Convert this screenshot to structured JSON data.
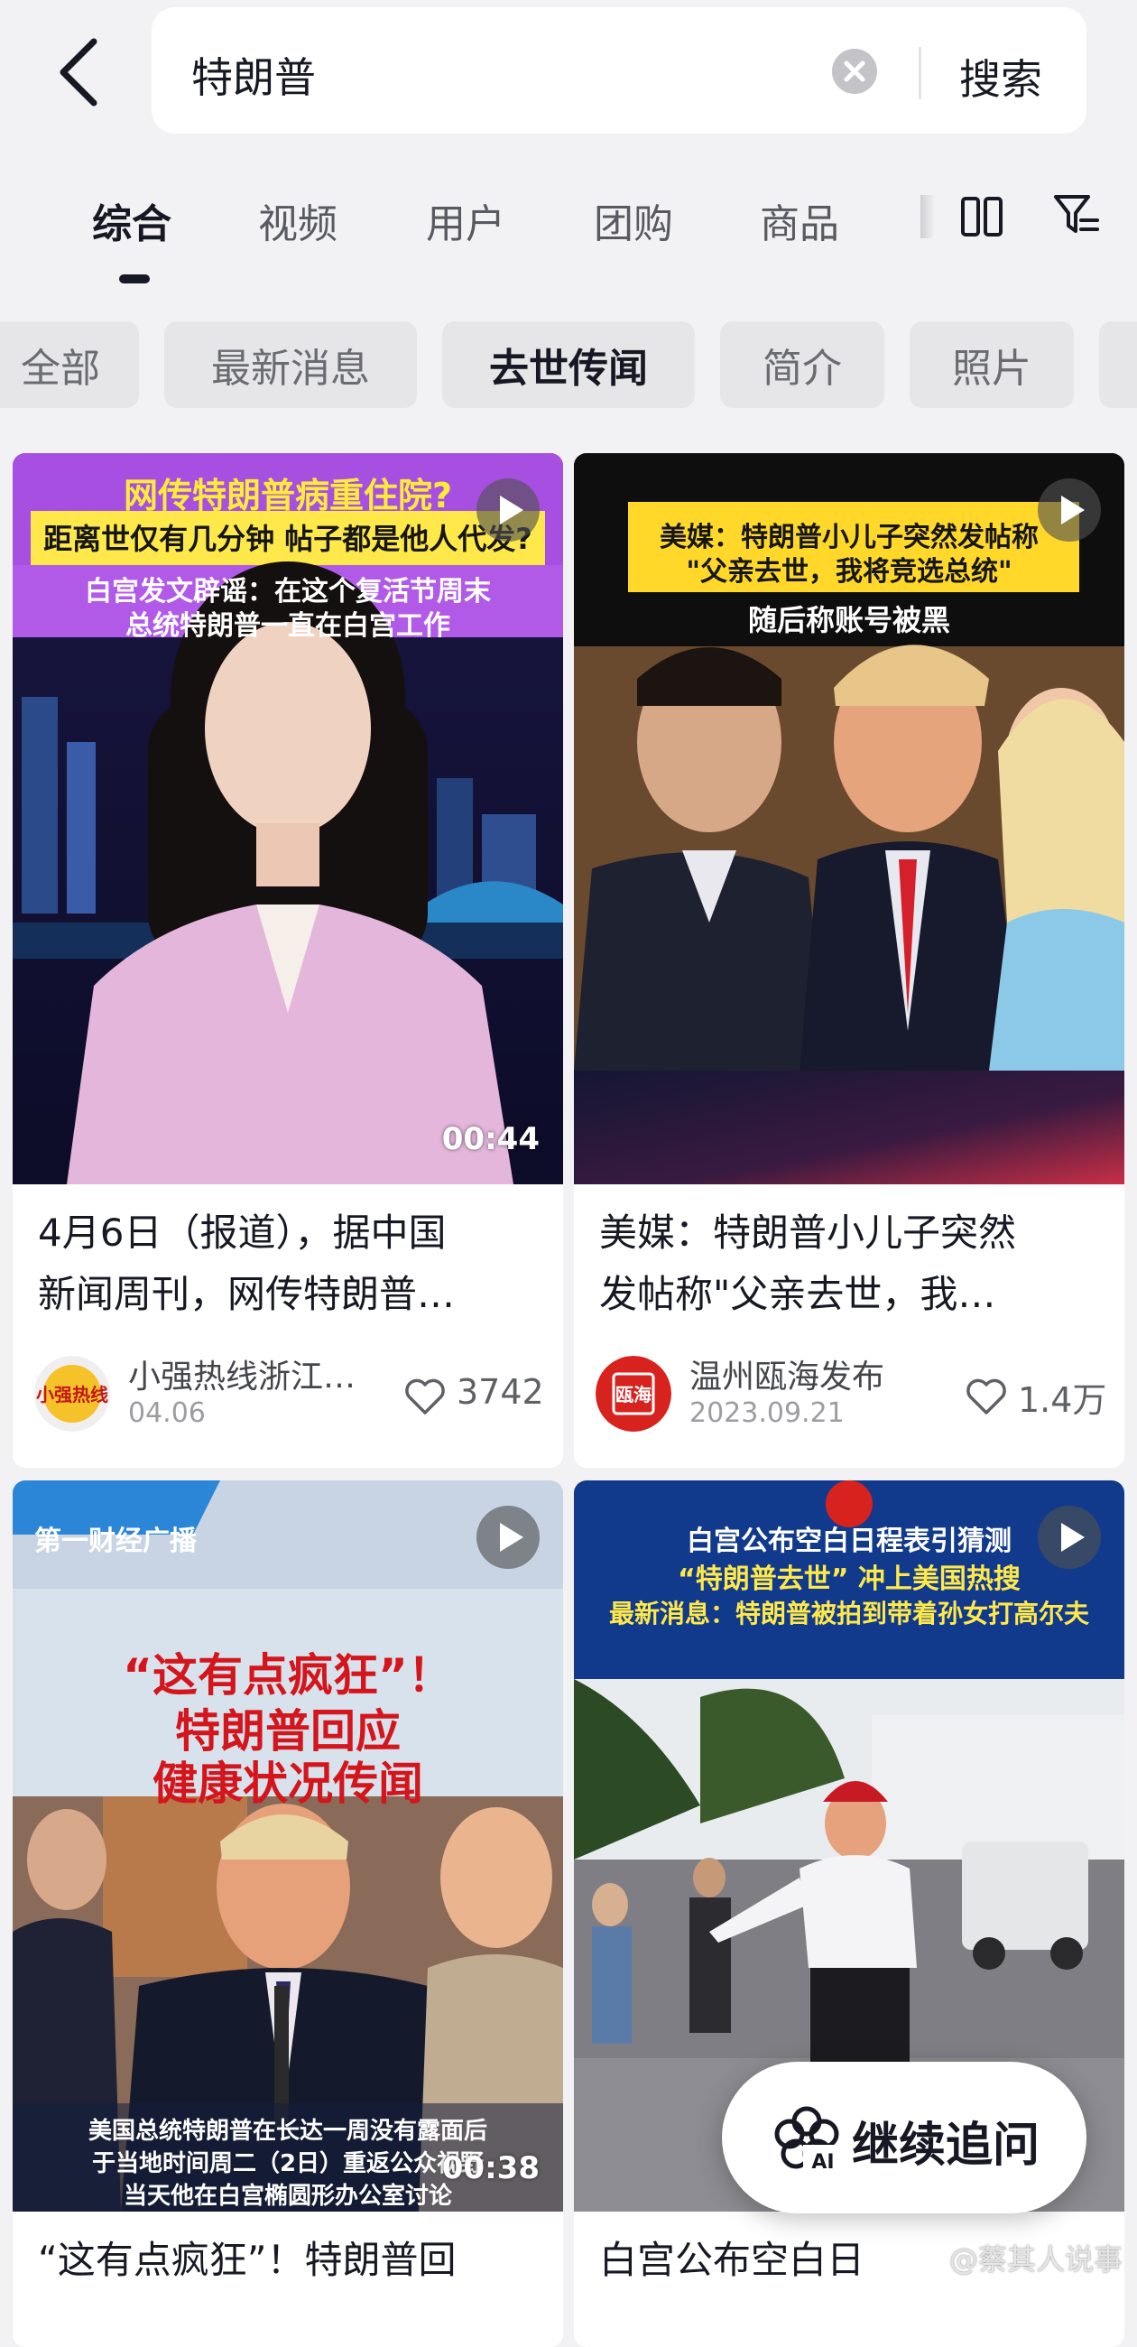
{
  "search": {
    "query": "特朗普",
    "submit_label": "搜索"
  },
  "tabs": [
    {
      "label": "综合",
      "active": true
    },
    {
      "label": "视频"
    },
    {
      "label": "用户"
    },
    {
      "label": "团购"
    },
    {
      "label": "商品"
    }
  ],
  "chips": [
    {
      "label": "全部"
    },
    {
      "label": "最新消息"
    },
    {
      "label": "去世传闻",
      "active": true
    },
    {
      "label": "简介"
    },
    {
      "label": "照片"
    }
  ],
  "results": [
    {
      "overlay": [
        "网传特朗普病重住院?",
        "距离世仅有几分钟 帖子都是他人代发?",
        "白宫发文辟谣：在这个复活节周末",
        "总统特朗普一直在白宫工作"
      ],
      "duration": "00:44",
      "title_lines": [
        "4月6日（报道），据中国",
        "新闻周刊，网传特朗普…"
      ],
      "author": "小强热线浙江…",
      "date": "04.06",
      "likes": "3742",
      "avatar_text": "小强热线"
    },
    {
      "overlay": [
        "美媒：特朗普小儿子突然发帖称",
        "\"父亲去世，我将竞选总统\"",
        "随后称账号被黑"
      ],
      "duration": "",
      "title_lines": [
        "美媒：特朗普小儿子突然",
        "发帖称\"父亲去世，我…"
      ],
      "author": "温州瓯海发布",
      "date": "2023.09.21",
      "likes": "1.4万",
      "avatar_text": "瓯海"
    },
    {
      "overlay": [
        "第一财经广播",
        "“这有点疯狂”！",
        "特朗普回应",
        "健康状况传闻",
        "美国总统特朗普在长达一周没有露面后",
        "于当地时间周二（2日）重返公众视野",
        "当天他在白宫椭圆形办公室讨论"
      ],
      "duration": "00:38",
      "title_lines": [
        "“这有点疯狂”！特朗普回"
      ],
      "author": "",
      "date": "",
      "likes": ""
    },
    {
      "overlay": [
        "白宫公布空白日程表引猜测",
        "“特朗普去世” 冲上美国热搜",
        "最新消息：特朗普被拍到带着孙女打高尔夫"
      ],
      "duration": "",
      "title_lines": [
        "白宫公布空白日"
      ],
      "author": "",
      "date": "",
      "likes": ""
    }
  ],
  "floating_button": {
    "label": "继续追问",
    "icon_text": "AI"
  },
  "watermark": "@蔡其人说事"
}
